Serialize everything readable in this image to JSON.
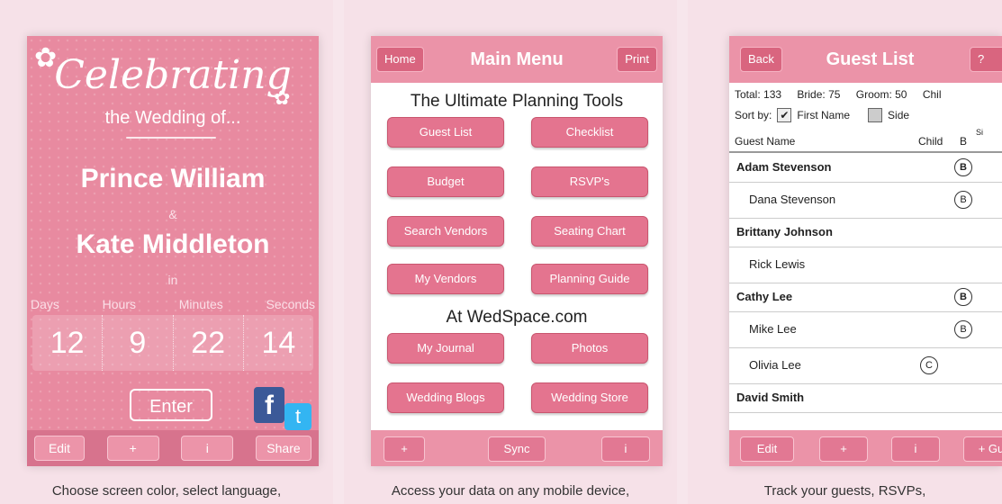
{
  "panel1": {
    "caption": "Choose screen color, select language,",
    "title": "Celebrating",
    "subtitle": "the Wedding of...",
    "groom": "Prince William",
    "amp": "&",
    "bride": "Kate Middleton",
    "in_text": "in",
    "units": [
      "Days",
      "Hours",
      "Minutes",
      "Seconds"
    ],
    "values": [
      "12",
      "9",
      "22",
      "14"
    ],
    "enter": "Enter",
    "toolbar": [
      "Edit",
      "+",
      "i",
      "Share"
    ],
    "facebook_glyph": "f",
    "twitter_glyph": "t"
  },
  "panel2": {
    "caption": "Access your data on any mobile device,",
    "nav": {
      "home": "Home",
      "title": "Main Menu",
      "print": "Print"
    },
    "heading1": "The Ultimate Planning Tools",
    "tools": [
      "Guest List",
      "Checklist",
      "Budget",
      "RSVP's",
      "Search Vendors",
      "Seating Chart",
      "My Vendors",
      "Planning Guide"
    ],
    "heading2": "At WedSpace.com",
    "wedspace": [
      "My Journal",
      "Photos",
      "Wedding Blogs",
      "Wedding Store"
    ],
    "bottom": [
      "+",
      "Sync",
      "i"
    ]
  },
  "panel3": {
    "caption": "Track your guests, RSVPs,",
    "nav": {
      "back": "Back",
      "title": "Guest List",
      "help": "?"
    },
    "stats": [
      "Total: 133",
      "Bride: 75",
      "Groom: 50",
      "Chil"
    ],
    "sort_label": "Sort by:",
    "sort_first_name": "First Name",
    "sort_side": "Side",
    "columns": {
      "name": "Guest Name",
      "child": "Child",
      "b": "B",
      "s": "Si"
    },
    "guests": [
      {
        "name": "Adam Stevenson",
        "badge": "B"
      },
      {
        "name": "Dana Stevenson",
        "badge": "B"
      },
      {
        "name": "Brittany Johnson",
        "badge": ""
      },
      {
        "name": "Rick Lewis",
        "badge": ""
      },
      {
        "name": "Cathy Lee",
        "badge": "B"
      },
      {
        "name": "Mike Lee",
        "badge": "B"
      },
      {
        "name": "Olivia Lee",
        "badge": "C"
      },
      {
        "name": "David Smith",
        "badge": ""
      }
    ],
    "bottom": [
      "Edit",
      "+",
      "i",
      "+ Gu"
    ]
  }
}
